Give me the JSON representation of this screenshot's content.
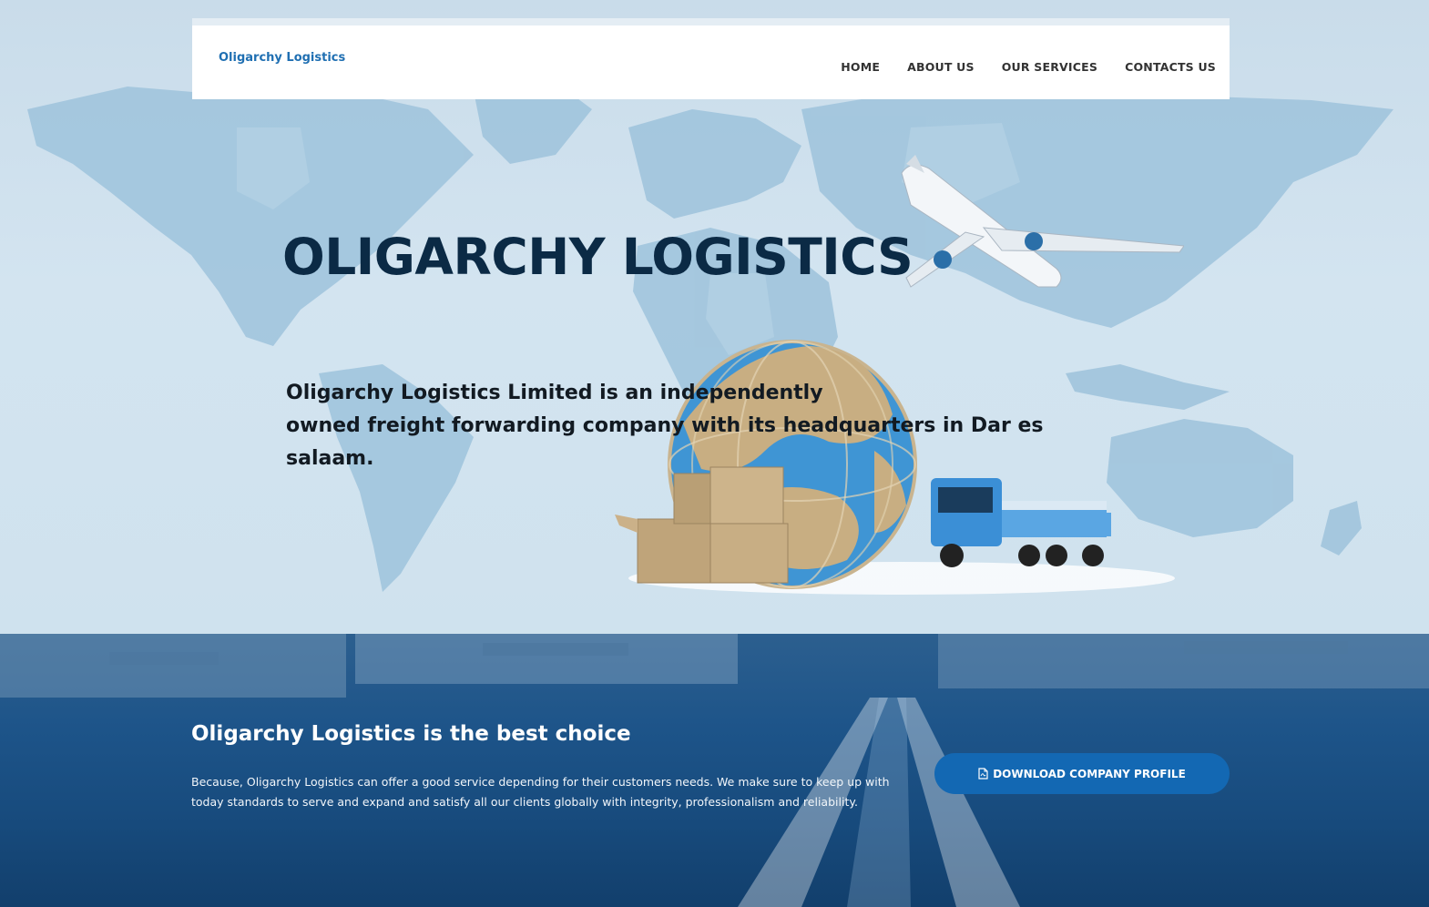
{
  "header": {
    "brand": "Oligarchy Logistics",
    "nav": [
      "HOME",
      "ABOUT US",
      "OUR SERVICES",
      "CONTACTS US"
    ]
  },
  "hero": {
    "title": "OLIGARCHY LOGISTICS",
    "description_line1": "Oligarchy Logistics Limited is an independently",
    "description_line2": "owned freight forwarding company with its headquarters in Dar es salaam."
  },
  "promo": {
    "title": "Oligarchy Logistics is the best choice",
    "text": "Because, Oligarchy Logistics can offer a good service depending for their customers needs. We make sure to keep up with today standards to serve and expand and satisfy all our clients globally with integrity, professionalism and reliability.",
    "button_label": "DOWNLOAD COMPANY PROFILE",
    "button_icon": "pdf-file-icon"
  },
  "colors": {
    "brand": "#1f6fb2",
    "hero_title": "#0b2a45",
    "button": "#1368b3",
    "promo_bg": "#174a7c"
  }
}
